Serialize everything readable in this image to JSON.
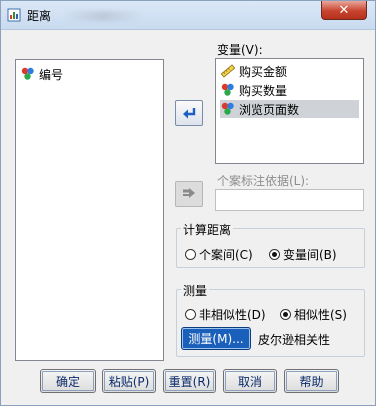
{
  "window": {
    "title": "距离",
    "close_label": "✕"
  },
  "left_list": {
    "items": [
      {
        "label": "编号",
        "icon": "nominal-variable-icon"
      }
    ]
  },
  "variables": {
    "label": "变量(V):",
    "items": [
      {
        "label": "购买金额",
        "icon": "scale-variable-icon",
        "selected": false
      },
      {
        "label": "购买数量",
        "icon": "nominal-variable-icon",
        "selected": false
      },
      {
        "label": "浏览页面数",
        "icon": "nominal-variable-icon",
        "selected": true
      }
    ]
  },
  "case_label": {
    "label": "个案标注依据(L):",
    "value": ""
  },
  "compute_distance": {
    "title": "计算距离",
    "options": [
      {
        "label": "个案间(C)",
        "checked": false
      },
      {
        "label": "变量间(B)",
        "checked": true
      }
    ]
  },
  "measure": {
    "title": "测量",
    "options": [
      {
        "label": "非相似性(D)",
        "checked": false
      },
      {
        "label": "相似性(S)",
        "checked": true
      }
    ],
    "button_label": "测量(M)...",
    "current": "皮尔逊相关性"
  },
  "buttons": {
    "ok": "确定",
    "paste": "粘贴(P)",
    "reset": "重置(R)",
    "cancel": "取消",
    "help": "帮助"
  }
}
